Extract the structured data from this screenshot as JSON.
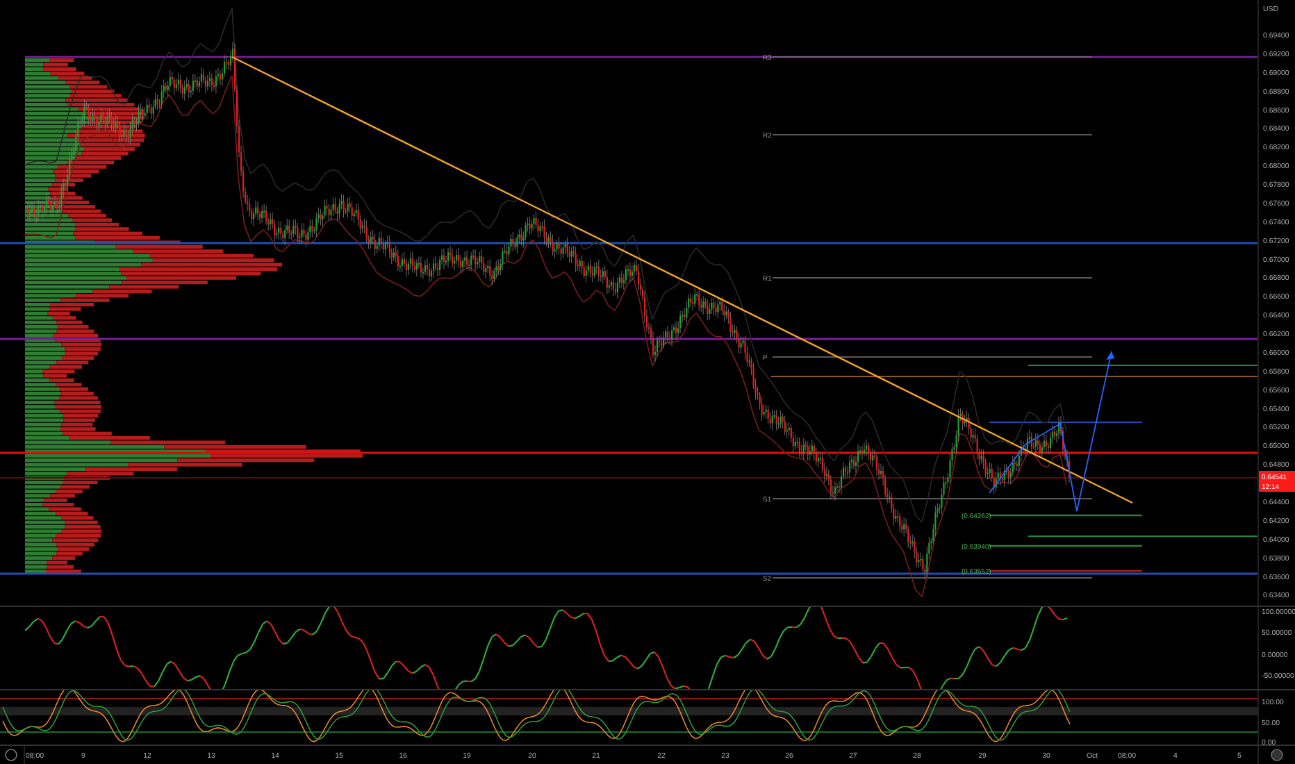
{
  "price_axis": {
    "currency": "USD",
    "ticks": [
      "0.69400",
      "0.69200",
      "0.69000",
      "0.68800",
      "0.68600",
      "0.68400",
      "0.68200",
      "0.68000",
      "0.67800",
      "0.67600",
      "0.67400",
      "0.67200",
      "0.67000",
      "0.66800",
      "0.66600",
      "0.66400",
      "0.66200",
      "0.66000",
      "0.65800",
      "0.65600",
      "0.65400",
      "0.65200",
      "0.65000",
      "0.64800",
      "0.64400",
      "0.64200",
      "0.64000",
      "0.63800",
      "0.63600",
      "0.63400"
    ]
  },
  "current_price": {
    "price": "0.64541",
    "countdown": "12:14"
  },
  "pivot_labels": [
    "R3",
    "R2",
    "R1",
    "P",
    "S1",
    "S2"
  ],
  "fib_labels": [
    "(0.64262)",
    "(0.63940)",
    "(0.63652)"
  ],
  "oscillator_axis": {
    "ticks": [
      "100.00000",
      "50.00000",
      "0.00000",
      "-50.00000"
    ]
  },
  "stochastic_axis": {
    "ticks": [
      "100.00",
      "50.00",
      "0.00"
    ]
  },
  "time_axis": {
    "labels": [
      "08:00",
      "9",
      "12",
      "13",
      "14",
      "15",
      "16",
      "19",
      "20",
      "21",
      "22",
      "23",
      "26",
      "27",
      "28",
      "29",
      "30",
      "Oct",
      "08:00",
      "4",
      "5"
    ]
  }
}
